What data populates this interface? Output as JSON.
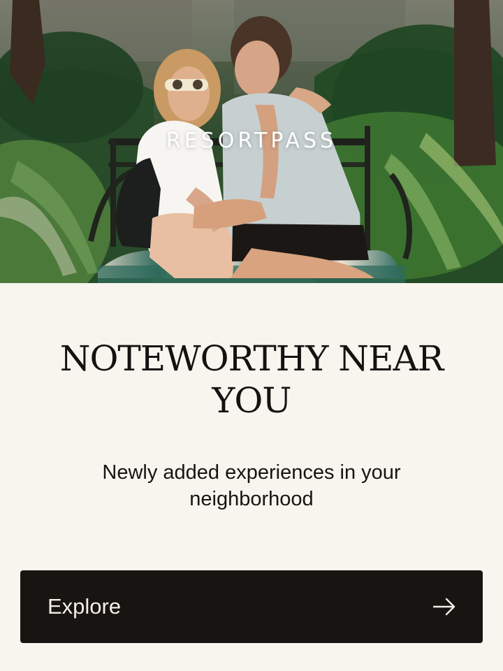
{
  "hero": {
    "brand": "RESORTPASS"
  },
  "content": {
    "headline": "NOTEWORTHY NEAR YOU",
    "subtitle": "Newly added experiences in your neighborhood"
  },
  "actions": {
    "explore_label": "Explore"
  },
  "icons": {
    "explore_arrow": "arrow-right-icon"
  },
  "colors": {
    "background": "#f8f5ef",
    "button_background": "#171412",
    "button_text": "#f4efe6",
    "text": "#161412"
  }
}
